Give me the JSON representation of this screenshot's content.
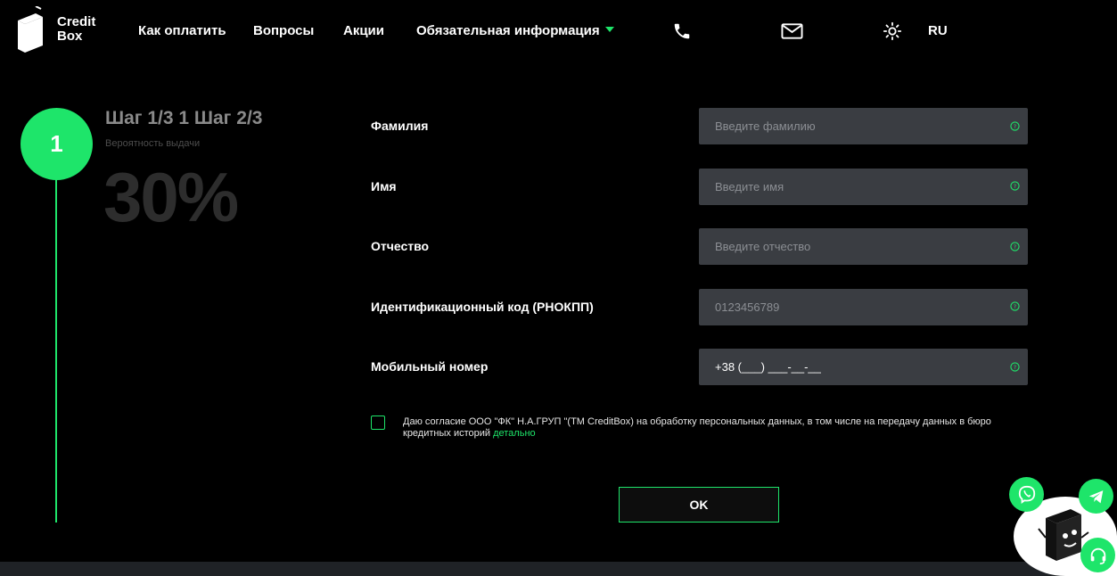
{
  "header": {
    "logo_line1": "Credit",
    "logo_line2": "Box",
    "nav": [
      "Как оплатить",
      "Вопросы",
      "Акции",
      "Обязательная информация"
    ],
    "icons": {
      "phone": "phone-icon",
      "mail": "mail-icon",
      "theme": "sun-icon"
    },
    "lang": "RU"
  },
  "progress": {
    "step_number": "1",
    "step_title": "Шаг 1/3 1 Шаг 2/3",
    "probability_label": "Вероятность выдачи",
    "probability_value": "30%"
  },
  "form": {
    "fields": [
      {
        "label": "Фамилия",
        "placeholder": "Введите фамилию",
        "value": ""
      },
      {
        "label": "Имя",
        "placeholder": "Введите имя",
        "value": ""
      },
      {
        "label": "Отчество",
        "placeholder": "Введите отчество",
        "value": ""
      },
      {
        "label": "Идентификационный код (РНОКПП)",
        "placeholder": "0123456789",
        "value": ""
      },
      {
        "label": "Мобильный номер",
        "placeholder": "",
        "value": "+38 (___) ___-__-__"
      }
    ],
    "consent_text": "Даю согласие ООО \"ФК\" Н.А.ГРУП \"(ТМ CreditBox) на обработку персональных данных, в том числе на передачу данных в бюро кредитных историй",
    "consent_link": "детально",
    "consent_checked": false,
    "submit_label": "OK"
  },
  "colors": {
    "accent": "#1ee56a",
    "background": "#000000",
    "input_bg": "#3a3d42"
  }
}
